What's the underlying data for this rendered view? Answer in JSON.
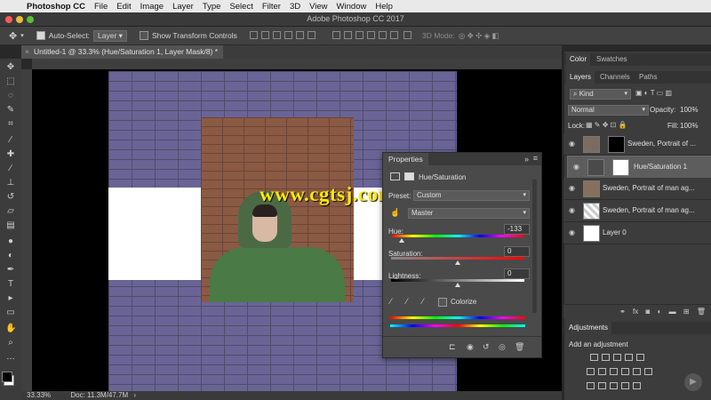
{
  "menubar": {
    "app_name": "Photoshop CC",
    "items": [
      "File",
      "Edit",
      "Image",
      "Layer",
      "Type",
      "Select",
      "Filter",
      "3D",
      "View",
      "Window",
      "Help"
    ]
  },
  "titlebar": {
    "title": "Adobe Photoshop CC 2017"
  },
  "options": {
    "auto_select_label": "Auto-Select:",
    "auto_select_value": "Layer",
    "show_transform_label": "Show Transform Controls",
    "mode_3d_label": "3D Mode:"
  },
  "document": {
    "tab_title": "Untitled-1 @ 33.3% (Hue/Saturation 1, Layer Mask/8) *"
  },
  "watermark_text": "www.cgtsj.com",
  "status": {
    "zoom": "33.33%",
    "doc_info": "Doc: 11.3M/47.7M"
  },
  "properties": {
    "panel_title": "Properties",
    "adjustment_name": "Hue/Saturation",
    "preset_label": "Preset:",
    "preset_value": "Custom",
    "channel_value": "Master",
    "hue_label": "Hue:",
    "hue_value": "-133",
    "saturation_label": "Saturation:",
    "saturation_value": "0",
    "lightness_label": "Lightness:",
    "lightness_value": "0",
    "colorize_label": "Colorize",
    "hue_slider_fraction": 0.08,
    "saturation_slider_fraction": 0.5,
    "lightness_slider_fraction": 0.5
  },
  "right_panels": {
    "top_tabs": [
      "Color",
      "Swatches"
    ],
    "layers_tabs": [
      "Layers",
      "Channels",
      "Paths"
    ],
    "kind_label": "Kind",
    "blend_mode": "Normal",
    "opacity_label": "Opacity:",
    "opacity_value": "100%",
    "lock_label": "Lock:",
    "fill_label": "Fill:",
    "fill_value": "100%",
    "layers": [
      {
        "name": "Sweden, Portrait of ..."
      },
      {
        "name": "Hue/Saturation 1"
      },
      {
        "name": "Sweden, Portrait of man ag..."
      },
      {
        "name": "Sweden, Portrait of man ag..."
      },
      {
        "name": "Layer 0"
      }
    ],
    "adjustments_tab": "Adjustments",
    "add_adjustment_label": "Add an adjustment"
  },
  "colors": {
    "accent_selected": "#5d5d5d",
    "watermark": "#ffe800"
  }
}
